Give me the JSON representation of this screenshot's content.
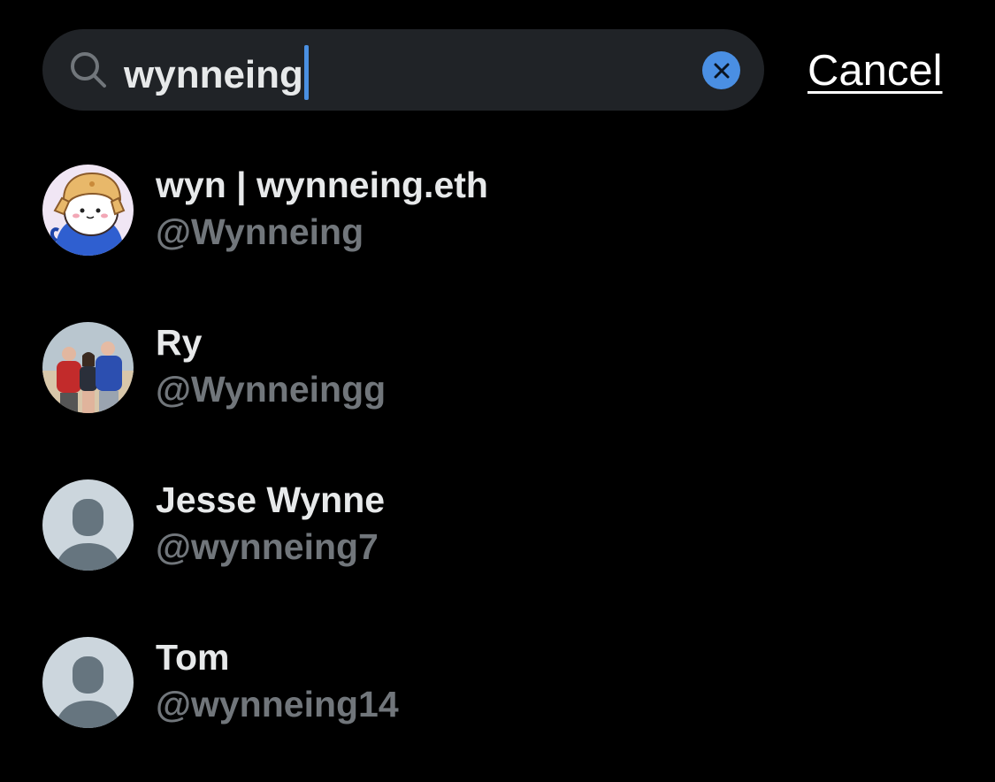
{
  "search": {
    "query": "wynneing",
    "cancel_label": "Cancel",
    "icon": "search-icon",
    "clear_icon": "close-icon"
  },
  "results": [
    {
      "name": "wyn | wynneing.eth",
      "handle": "@Wynneing",
      "avatar": "cartoon-seal-avatar"
    },
    {
      "name": "Ry",
      "handle": "@Wynneingg",
      "avatar": "group-photo-avatar"
    },
    {
      "name": "Jesse Wynne",
      "handle": "@wynneing7",
      "avatar": "default-avatar"
    },
    {
      "name": "Tom",
      "handle": "@wynneing14",
      "avatar": "default-avatar"
    }
  ],
  "colors": {
    "background": "#000000",
    "search_field": "#202327",
    "accent": "#4a8fe3",
    "primary_text": "#e7e9ea",
    "secondary_text": "#71767b",
    "default_avatar_bg": "#ccd6dd",
    "default_avatar_fg": "#66757f"
  }
}
